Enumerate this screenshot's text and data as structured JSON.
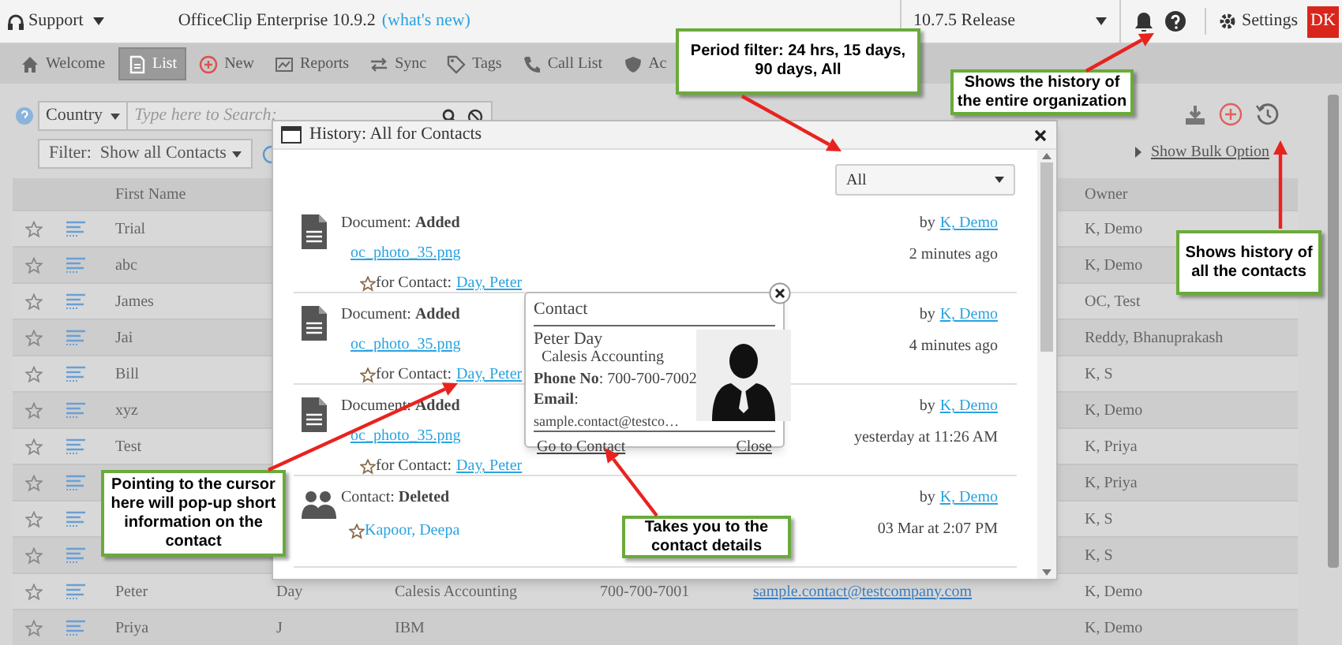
{
  "top_bar": {
    "menu": "Support",
    "product": "OfficeClip Enterprise 10.9.2",
    "whats_new": "(what's new)",
    "release": "10.7.5 Release",
    "settings": "Settings",
    "avatar": "DK"
  },
  "nav_tabs": [
    {
      "label": "Welcome",
      "selected": false
    },
    {
      "label": "List",
      "selected": true
    },
    {
      "label": "New",
      "selected": false
    },
    {
      "label": "Reports",
      "selected": false
    },
    {
      "label": "Sync",
      "selected": false
    },
    {
      "label": "Tags",
      "selected": false
    },
    {
      "label": "Call List",
      "selected": false
    },
    {
      "label": "Ac",
      "selected": false
    }
  ],
  "search": {
    "scope": "Country",
    "placeholder": "Type here to Search:",
    "filter": "Filter:  Show all Contacts"
  },
  "bulk_link": "Show Bulk Option",
  "table": {
    "columns": [
      "First Name",
      "Owner"
    ],
    "rows": [
      {
        "first_name": "Trial",
        "owner": "K, Demo"
      },
      {
        "first_name": "abc",
        "owner": "K, Demo"
      },
      {
        "first_name": "James",
        "owner": "OC, Test"
      },
      {
        "first_name": "Jai",
        "owner": "Reddy, Bhanuprakash"
      },
      {
        "first_name": "Bill",
        "owner": "K, S"
      },
      {
        "first_name": "xyz",
        "owner": "K, Demo"
      },
      {
        "first_name": "Test",
        "owner": "K, Priya"
      },
      {
        "owner": "K, Priya"
      },
      {
        "owner": "K, S"
      },
      {
        "owner": "K, S"
      },
      {
        "first_name": "Peter",
        "column_4": "Day",
        "column_5": "Calesis Accounting",
        "column_6": "700-700-7001",
        "column_7": "sample.contact@testcompany.com",
        "owner": "K, Demo"
      },
      {
        "first_name": "Priya",
        "column_4": "J",
        "column_5": "IBM",
        "owner": "K, Demo"
      }
    ]
  },
  "history_dialog": {
    "title": "History: All for Contacts",
    "period": "All",
    "entries": [
      {
        "kind": "document",
        "event": "Document: **Added**",
        "file": "oc_photo_35.png",
        "for_label": "for Contact:",
        "contact": "Day, Peter",
        "by_label": "by",
        "user": "K, Demo",
        "time": "2 minutes ago"
      },
      {
        "kind": "document",
        "event": "Document: **Added**",
        "file": "oc_photo_35.png",
        "for_label": "for Contact:",
        "contact": "Day, Peter",
        "by_label": "by",
        "user": "K, Demo",
        "time": "4 minutes ago"
      },
      {
        "kind": "document",
        "event": "Document: **Added**",
        "file": "oc_photo_35.png",
        "for_label": "for Contact:",
        "contact": "Day, Peter",
        "by_label": "by",
        "user": "K, Demo",
        "time": "yesterday at 11:26 AM"
      },
      {
        "kind": "contact",
        "event": "Contact: **Deleted**",
        "contact": "Kapoor, Deepa",
        "by_label": "by",
        "user": "K, Demo",
        "time": "03 Mar at 2:07 PM"
      }
    ]
  },
  "contact_popup": {
    "title": "Contact",
    "name": "Peter Day",
    "company": "Calesis Accounting",
    "phone": "**Phone No**: 700-700-7002",
    "email_label": "**Email**:",
    "email": "sample.contact@testco…",
    "go_link": "Go to Contact",
    "close_link": "Close"
  },
  "callouts": [
    "Period filter: 24 hrs, 15 days, 90 days, All",
    "Shows the history of the entire organization",
    "Shows history of all the contacts",
    "Pointing to the cursor here will pop-up short information on the contact",
    "Takes you to the contact details"
  ]
}
